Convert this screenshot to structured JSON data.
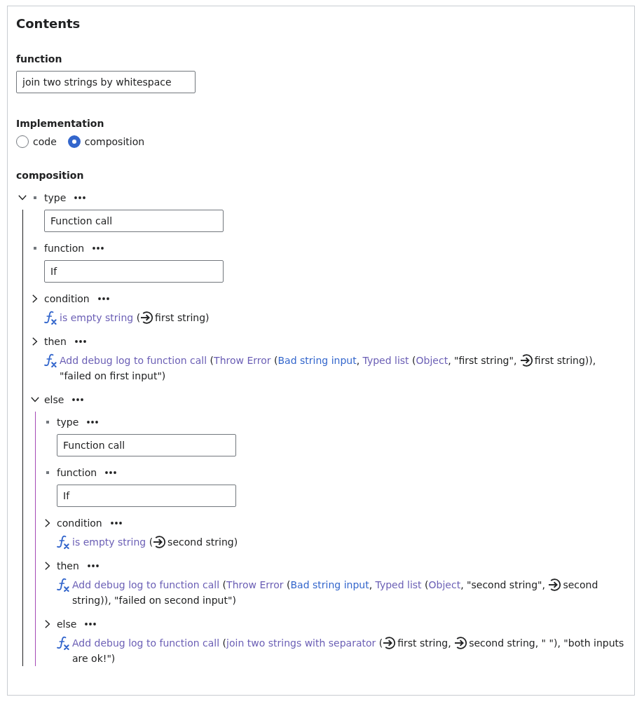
{
  "page": {
    "title": "Contents"
  },
  "function_field": {
    "label": "function",
    "value": "join two strings by whitespace"
  },
  "implementation": {
    "label": "Implementation",
    "options": [
      {
        "label": "code",
        "selected": false
      },
      {
        "label": "composition",
        "selected": true
      }
    ]
  },
  "composition": {
    "label": "composition",
    "expanded": true,
    "entries": [
      {
        "key": "type",
        "kind": "field",
        "value": "Function call"
      },
      {
        "key": "function",
        "kind": "field",
        "value": "If"
      },
      {
        "key": "condition",
        "kind": "call",
        "expanded": false,
        "summary": [
          {
            "kind": "link",
            "text": "is empty string",
            "visited": true
          },
          {
            "kind": "text",
            "text": " ("
          },
          {
            "kind": "arg",
            "text": "first string"
          },
          {
            "kind": "text",
            "text": ")"
          }
        ]
      },
      {
        "key": "then",
        "kind": "call",
        "expanded": false,
        "summary": [
          {
            "kind": "link",
            "text": "Add debug log to function call",
            "visited": true
          },
          {
            "kind": "text",
            "text": " ("
          },
          {
            "kind": "link",
            "text": "Throw Error",
            "visited": true
          },
          {
            "kind": "text",
            "text": " ("
          },
          {
            "kind": "link",
            "text": "Bad string input",
            "visited": false
          },
          {
            "kind": "text",
            "text": ", "
          },
          {
            "kind": "link",
            "text": "Typed list",
            "visited": true
          },
          {
            "kind": "text",
            "text": " ("
          },
          {
            "kind": "link",
            "text": "Object",
            "visited": true
          },
          {
            "kind": "text",
            "text": ", \"first string\", "
          },
          {
            "kind": "arg",
            "text": "first string"
          },
          {
            "kind": "text",
            "text": ")), \"failed on first input\")"
          }
        ]
      },
      {
        "key": "else",
        "kind": "object",
        "expanded": true,
        "entries": [
          {
            "key": "type",
            "kind": "field",
            "value": "Function call"
          },
          {
            "key": "function",
            "kind": "field",
            "value": "If"
          },
          {
            "key": "condition",
            "kind": "call",
            "expanded": false,
            "summary": [
              {
                "kind": "link",
                "text": "is empty string",
                "visited": true
              },
              {
                "kind": "text",
                "text": " ("
              },
              {
                "kind": "arg",
                "text": "second string"
              },
              {
                "kind": "text",
                "text": ")"
              }
            ]
          },
          {
            "key": "then",
            "kind": "call",
            "expanded": false,
            "summary": [
              {
                "kind": "link",
                "text": "Add debug log to function call",
                "visited": true
              },
              {
                "kind": "text",
                "text": " ("
              },
              {
                "kind": "link",
                "text": "Throw Error",
                "visited": true
              },
              {
                "kind": "text",
                "text": " ("
              },
              {
                "kind": "link",
                "text": "Bad string input",
                "visited": false
              },
              {
                "kind": "text",
                "text": ", "
              },
              {
                "kind": "link",
                "text": "Typed list",
                "visited": true
              },
              {
                "kind": "text",
                "text": " ("
              },
              {
                "kind": "link",
                "text": "Object",
                "visited": true
              },
              {
                "kind": "text",
                "text": ", \"second string\", "
              },
              {
                "kind": "arg",
                "text": "second string"
              },
              {
                "kind": "text",
                "text": ")), \"failed on second input\")"
              }
            ]
          },
          {
            "key": "else",
            "kind": "call",
            "expanded": false,
            "summary": [
              {
                "kind": "link",
                "text": "Add debug log to function call",
                "visited": true
              },
              {
                "kind": "text",
                "text": " ("
              },
              {
                "kind": "link",
                "text": "join two strings with separator",
                "visited": true
              },
              {
                "kind": "text",
                "text": " ("
              },
              {
                "kind": "arg",
                "text": "first string"
              },
              {
                "kind": "text",
                "text": ", "
              },
              {
                "kind": "arg",
                "text": "second string"
              },
              {
                "kind": "text",
                "text": ", \" \"), \"both inputs are ok!\")"
              }
            ]
          }
        ]
      }
    ]
  }
}
